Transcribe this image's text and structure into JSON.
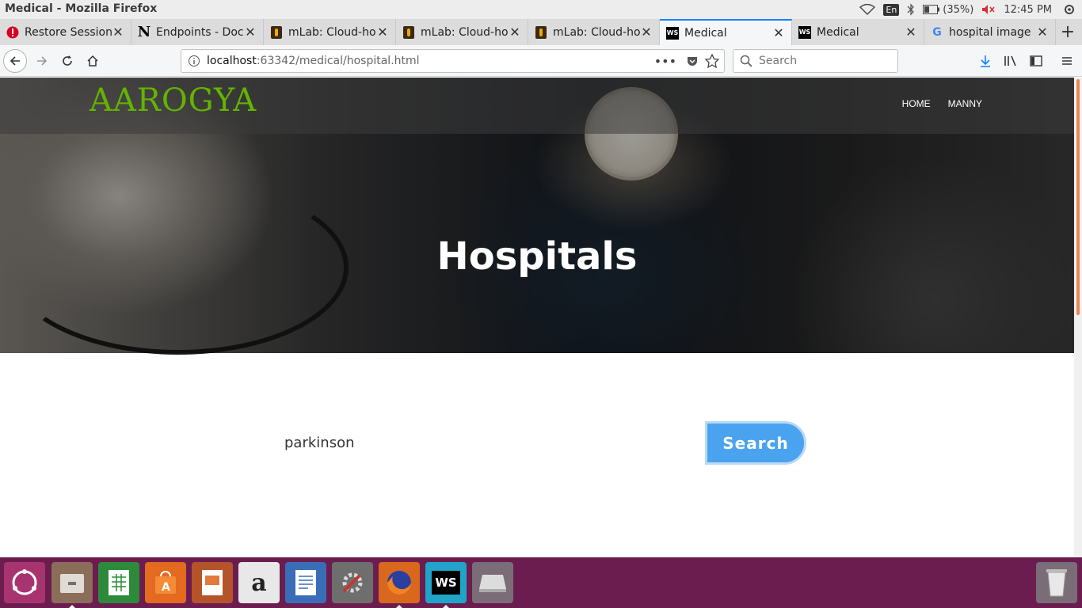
{
  "window": {
    "title": "Medical - Mozilla Firefox"
  },
  "tray": {
    "keyboard_layout": "En",
    "battery": "(35%)",
    "clock": "12:45 PM"
  },
  "tabs": [
    {
      "label": "Restore Session",
      "icon": "warning-icon",
      "active": false
    },
    {
      "label": "Endpoints - Doc",
      "icon": "notion-n-icon",
      "active": false
    },
    {
      "label": "mLab: Cloud-ho",
      "icon": "mlab-icon",
      "active": false
    },
    {
      "label": "mLab: Cloud-ho",
      "icon": "mlab-icon",
      "active": false
    },
    {
      "label": "mLab: Cloud-ho",
      "icon": "mlab-icon",
      "active": false
    },
    {
      "label": "Medical",
      "icon": "webstorm-icon",
      "active": true
    },
    {
      "label": "Medical",
      "icon": "webstorm-icon",
      "active": false
    },
    {
      "label": "hospital image",
      "icon": "google-icon",
      "active": false
    }
  ],
  "toolbar": {
    "url_host": "localhost",
    "url_path": ":63342/medical/hospital.html",
    "search_placeholder": "Search"
  },
  "site": {
    "brand": "AAROGYA",
    "nav": [
      {
        "label": "HOME"
      },
      {
        "label": "MANNY"
      }
    ],
    "hero_title": "Hospitals",
    "search_value": "parkinson",
    "search_button": "Search"
  },
  "dock": {
    "items": [
      "ubuntu-launcher-icon",
      "files-icon",
      "spreadsheet-icon",
      "software-center-icon",
      "presentation-icon",
      "amazon-icon",
      "writer-icon",
      "settings-icon",
      "firefox-icon",
      "webstorm-icon",
      "disk-icon",
      "trash-icon"
    ]
  },
  "colors": {
    "brand": "#63b400",
    "accent": "#4aa3ef",
    "dock": "#6b1d4f",
    "tab_active": "#0a84ff"
  }
}
